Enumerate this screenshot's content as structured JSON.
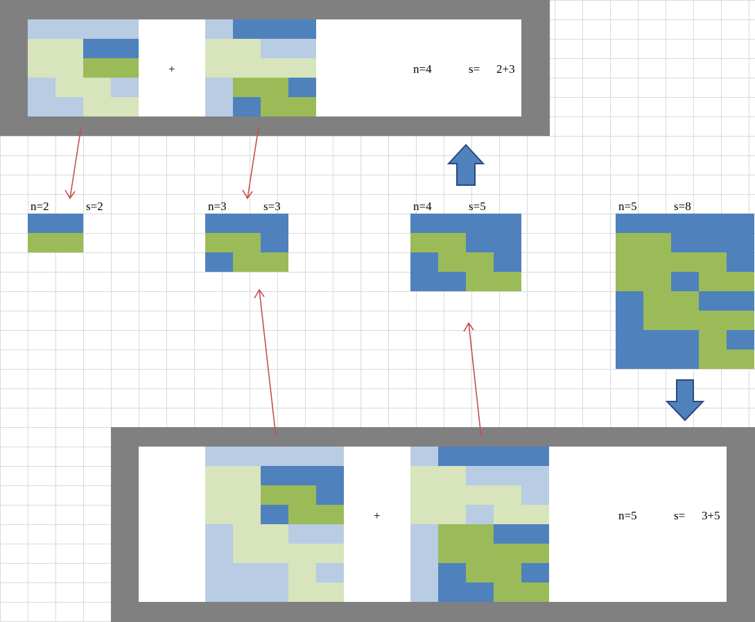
{
  "colors": {
    "dark_blue": "#4f81bd",
    "green": "#9bbb59",
    "light_blue": "#b8cce4",
    "light_green": "#d7e4bc",
    "frame_gray": "#808080",
    "arrow_red": "#c0504d"
  },
  "icons": [
    "up-block-arrow-icon",
    "down-block-arrow-icon"
  ],
  "top_panel": {
    "plus": "+",
    "n_label": "n=4",
    "s_label": "s=",
    "s_value": "2+3"
  },
  "bottom_panel": {
    "plus": "+",
    "n_label": "n=5",
    "s_label": "s=",
    "s_value": "3+5"
  },
  "tilings": [
    {
      "id": "n2",
      "n_label": "n=2",
      "s_label": "s=2"
    },
    {
      "id": "n3",
      "n_label": "n=3",
      "s_label": "s=3"
    },
    {
      "id": "n4",
      "n_label": "n=4",
      "s_label": "s=5"
    },
    {
      "id": "n5",
      "n_label": "n=5",
      "s_label": "s=8"
    }
  ]
}
